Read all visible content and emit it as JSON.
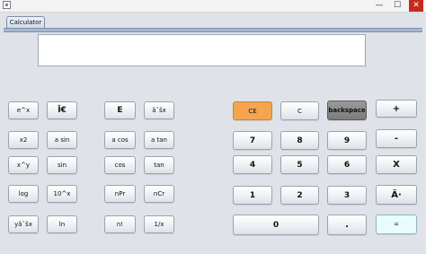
{
  "window": {
    "min_glyph": "—",
    "max_glyph": "☐",
    "close_glyph": "✕"
  },
  "tab": {
    "label": "Calculator"
  },
  "display": {
    "value": ""
  },
  "buttons": {
    "ex": "e^x",
    "pi": "Ï€",
    "e": "E",
    "root": "âˆšx",
    "x2": "x2",
    "asin": "a sin",
    "acos": "a cos",
    "atan": "a tan",
    "xy": "x^y",
    "sin": "sin",
    "cos": "cos",
    "tan": "tan",
    "log": "log",
    "tenx": "10^x",
    "npr": "nPr",
    "ncr": "nCr",
    "yroot": "yâˆšx",
    "ln": "ln",
    "fact": "n!",
    "inv": "1/x",
    "ce": "CE",
    "c": "C",
    "backspace": "backspace",
    "plus": "+",
    "n7": "7",
    "n8": "8",
    "n9": "9",
    "minus": "-",
    "n4": "4",
    "n5": "5",
    "n6": "6",
    "times": "X",
    "n1": "1",
    "n2": "2",
    "n3": "3",
    "divide": "Ã·",
    "n0": "0",
    "dot": ".",
    "equals": "="
  }
}
